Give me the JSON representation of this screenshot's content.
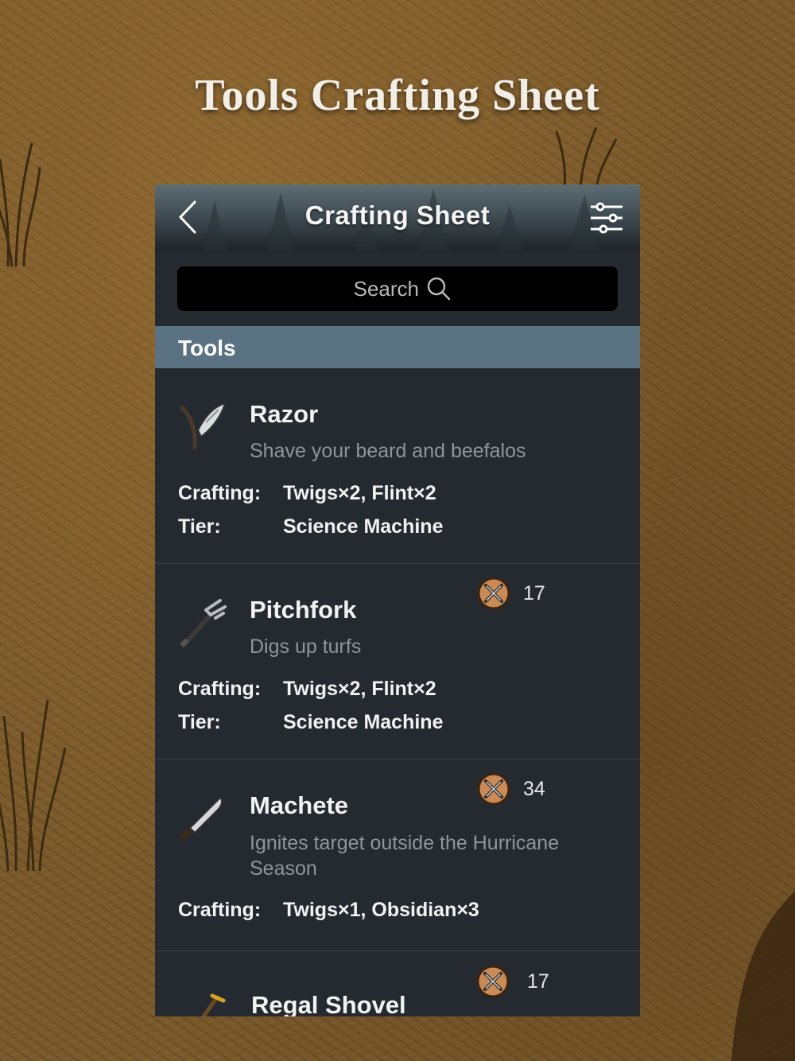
{
  "page_title": "Tools Crafting Sheet",
  "navbar": {
    "title": "Crafting Sheet",
    "back_icon": "chevron-left-icon",
    "filter_icon": "sliders-icon"
  },
  "search": {
    "placeholder": "Search",
    "icon": "search-icon"
  },
  "section": {
    "title": "Tools"
  },
  "items": [
    {
      "name": "Razor",
      "description": "Shave your beard and beefalos",
      "crafting_label": "Crafting:",
      "crafting": "Twigs×2, Flint×2",
      "tier_label": "Tier:",
      "tier": "Science Machine",
      "icon": "razor-icon"
    },
    {
      "name": "Pitchfork",
      "description": "Digs up turfs",
      "damage": "17",
      "crafting_label": "Crafting:",
      "crafting": "Twigs×2, Flint×2",
      "tier_label": "Tier:",
      "tier": "Science Machine",
      "icon": "pitchfork-icon"
    },
    {
      "name": "Machete",
      "description": "Ignites target outside the Hurricane Season",
      "damage": "34",
      "crafting_label": "Crafting:",
      "crafting": "Twigs×1, Obsidian×3",
      "icon": "machete-icon"
    },
    {
      "name": "Regal Shovel",
      "damage": "17",
      "icon": "shovel-icon"
    }
  ],
  "colors": {
    "section_header": "#5a7281",
    "panel": "#252a31",
    "description": "#8f959b"
  }
}
